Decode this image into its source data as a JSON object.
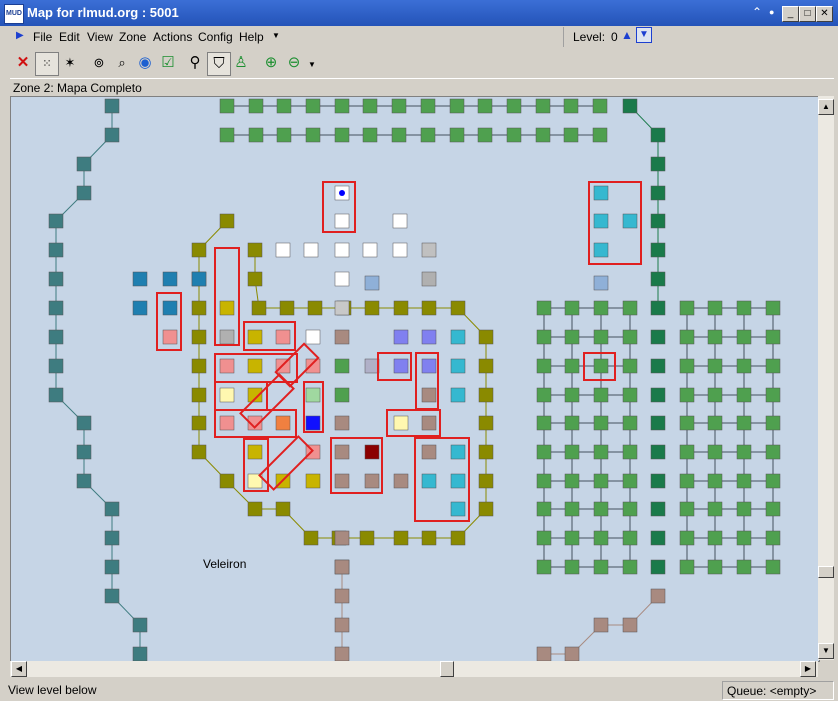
{
  "window": {
    "title": "Map for rlmud.org : 5001",
    "app_icon": "MUD"
  },
  "menu": [
    "File",
    "Edit",
    "View",
    "Zone",
    "Actions",
    "Config",
    "Help"
  ],
  "level": {
    "label": "Level:",
    "value": "0"
  },
  "zone_title": "Zone 2: Mapa Completo",
  "map": {
    "area_label": "Veleiron"
  },
  "status": {
    "left": "View level below",
    "queue": "Queue: <empty>"
  },
  "toolbar_icons": [
    "delete-icon",
    "grid-icon",
    "magic-icon",
    "binoculars-icon",
    "search-icon",
    "globe-icon",
    "check-icon",
    "path-icon",
    "shield-path-icon",
    "walker-icon",
    "zoom-in-icon",
    "zoom-out-icon"
  ],
  "colors": {
    "background": "#c6d5e6",
    "olive": "#8b8b00",
    "green": "#4fa04f",
    "dark_green": "#1a7a4a",
    "teal": "#3e7c80",
    "highlight": "#e02020",
    "cyan": "#35b8d0",
    "brown": "#a88a80"
  }
}
